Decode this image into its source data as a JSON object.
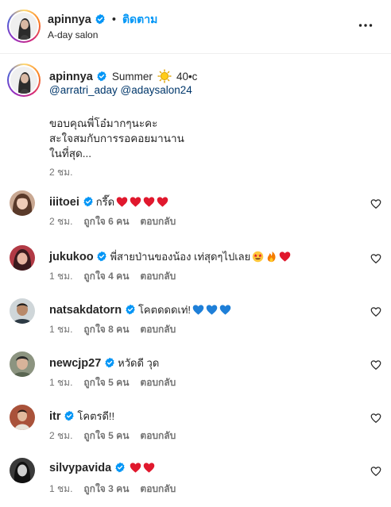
{
  "header": {
    "username": "apinnya",
    "dot": "•",
    "follow_label": "ติดตาม",
    "subtitle": "A-day salon",
    "more_icon": "more-horizontal-icon"
  },
  "caption": {
    "username": "apinnya",
    "summer_text": "Summer",
    "temp_text": "40•c",
    "mention1": "@arratri_aday",
    "mention2": "@adaysalon24",
    "line1": "ขอบคุณพี่โอ๋มากๆนะคะ",
    "line2": "สะใจสมกับการรอคอยมานาน",
    "line3": "ในที่สุด...",
    "time": "2 ชม."
  },
  "comments": [
    {
      "username": "iiitoei",
      "text": "กรี๊ด",
      "emojis": [
        "red-heart",
        "red-heart",
        "red-heart",
        "red-heart"
      ],
      "time": "2 ชม.",
      "likes": "ถูกใจ 6 คน",
      "reply": "ตอบกลับ"
    },
    {
      "username": "jukukoo",
      "text": "พี่สายป่านของน้อง เท่สุดๆไปเลย",
      "emojis": [
        "star-eyes",
        "fire",
        "red-heart"
      ],
      "time": "1 ชม.",
      "likes": "ถูกใจ 4 คน",
      "reply": "ตอบกลับ"
    },
    {
      "username": "natsakdatorn",
      "text": "โคตดดดเท่!",
      "emojis": [
        "blue-heart",
        "blue-heart",
        "blue-heart"
      ],
      "time": "1 ชม.",
      "likes": "ถูกใจ 8 คน",
      "reply": "ตอบกลับ"
    },
    {
      "username": "newcjp27",
      "text": "หวัดดี วุด",
      "emojis": [],
      "time": "1 ชม.",
      "likes": "ถูกใจ 5 คน",
      "reply": "ตอบกลับ"
    },
    {
      "username": "itr",
      "text": "โคตรดี!!",
      "emojis": [],
      "time": "2 ชม.",
      "likes": "ถูกใจ 5 คน",
      "reply": "ตอบกลับ"
    },
    {
      "username": "silvypavida",
      "text": "",
      "emojis": [
        "red-heart",
        "red-heart"
      ],
      "time": "1 ชม.",
      "likes": "ถูกใจ 3 คน",
      "reply": "ตอบกลับ"
    }
  ],
  "colors": {
    "accent": "#0095f6",
    "verified": "#0095f6",
    "mention": "#00376b",
    "muted": "#737373"
  }
}
